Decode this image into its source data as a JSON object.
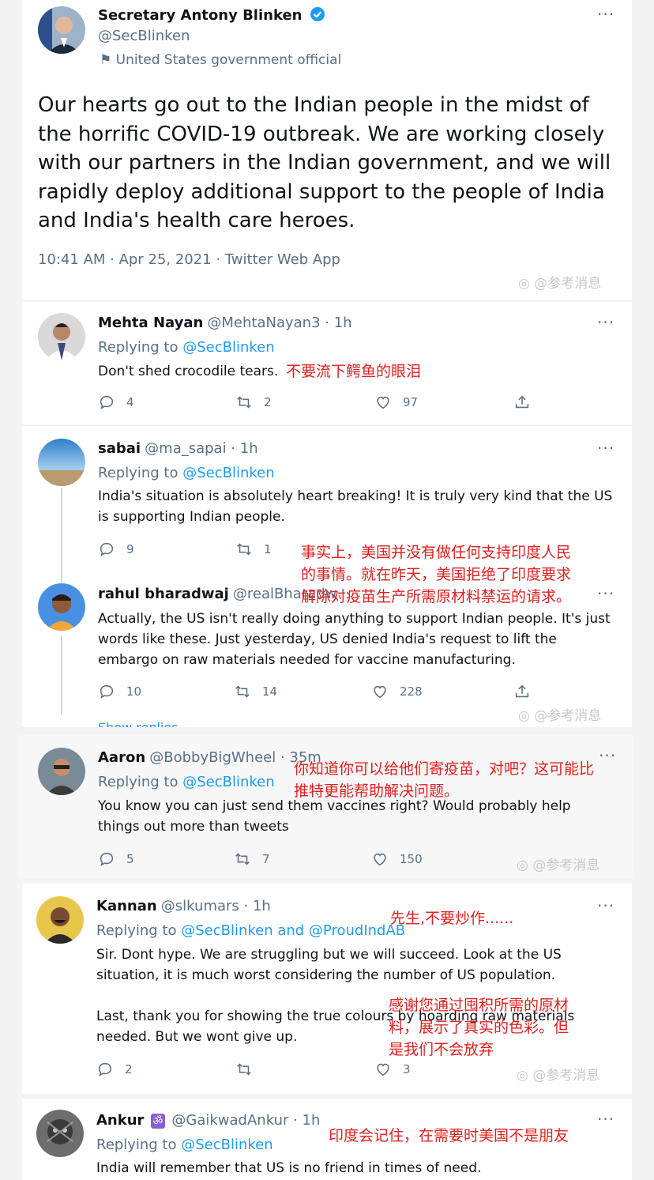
{
  "main_tweet": {
    "name": "Secretary Antony Blinken",
    "handle": "@SecBlinken",
    "label": "United States government official",
    "text_lines": [
      "Our hearts go out to the Indian people in the midst of",
      "the horrific COVID-19 outbreak. We are working closely",
      "with our partners in the Indian government, and we will",
      "rapidly deploy additional support to the people of India",
      "and India's health care heroes."
    ],
    "meta": "10:41 AM · Apr 25, 2021 · Twitter Web App",
    "more": "···"
  },
  "watermark": "@参考消息",
  "replying_prefix": "Replying to ",
  "replies": [
    {
      "name": "Mehta Nayan",
      "handle": "@MehtaNayan3 · 1h",
      "replying_to": "@SecBlinken",
      "text_lines": [
        "Don't shed crocodile tears."
      ],
      "cn": "不要流下鳄鱼的眼泪",
      "counts": {
        "reply": "4",
        "retweet": "2",
        "like": "97"
      }
    },
    {
      "name": "sabai",
      "handle": "@ma_sapai · 1h",
      "replying_to": "@SecBlinken",
      "text_lines": [
        "India's situation is absolutely heart breaking! It is truly very kind that the US",
        "is supporting Indian people."
      ],
      "counts": {
        "reply": "9",
        "retweet": "1",
        "like": ""
      }
    },
    {
      "name": "rahul bharadwaj",
      "handle": "@realBharadw",
      "text_lines": [
        "Actually, the US isn't really doing anything to support Indian people. It's just",
        "words like these. Just yesterday, US denied India's request to lift the",
        "embargo on raw materials needed for vaccine manufacturing."
      ],
      "cn_lines": [
        "事实上，美国并没有做任何支持印度人民",
        "的事情。就在昨天，美国拒绝了印度要求",
        "解除对疫苗生产所需原材料禁运的请求。"
      ],
      "counts": {
        "reply": "10",
        "retweet": "14",
        "like": "228"
      },
      "show_replies": "Show replies"
    },
    {
      "name": "Aaron",
      "handle": "@BobbyBigWheel · 35m",
      "replying_to": "@SecBlinken",
      "text_lines": [
        "You know you can just send them vaccines right?  Would probably help",
        "things out more than tweets"
      ],
      "cn_lines": [
        "你知道你可以给他们寄疫苗，对吧？这可能比",
        "推特更能帮助解决问题。"
      ],
      "counts": {
        "reply": "5",
        "retweet": "7",
        "like": "150"
      }
    },
    {
      "name": "Kannan",
      "handle": "@slkumars · 1h",
      "replying_to": "@SecBlinken and @ProudIndAB",
      "text_lines": [
        "Sir. Dont hype. We are struggling but we will succeed. Look at the US",
        "situation, it is much worst considering the number of US population.",
        "",
        "Last, thank you for showing the true colours by hoarding raw materials",
        "needed. But we wont give up."
      ],
      "cn": "先生,不要炒作......",
      "cn_lines": [
        "感谢您通过囤积所需的原材",
        "料，展示了真实的色彩。但",
        "是我们不会放弃"
      ],
      "counts": {
        "reply": "2",
        "retweet": "",
        "like": "3"
      }
    },
    {
      "name": "Ankur",
      "handle": "@GaikwadAnkur · 1h",
      "badge": "ॐ",
      "replying_to": "@SecBlinken",
      "text_lines": [
        "India will remember that US is no friend in times of need."
      ],
      "cn": "印度会记住，在需要时美国不是朋友"
    }
  ],
  "colors": {
    "link": "#1d9bf0",
    "annotation": "#e02020",
    "verified": "#1d9bf0"
  },
  "icons": [
    "verified-badge-icon",
    "flag-icon",
    "reply-icon",
    "retweet-icon",
    "like-icon",
    "share-icon",
    "more-icon"
  ]
}
